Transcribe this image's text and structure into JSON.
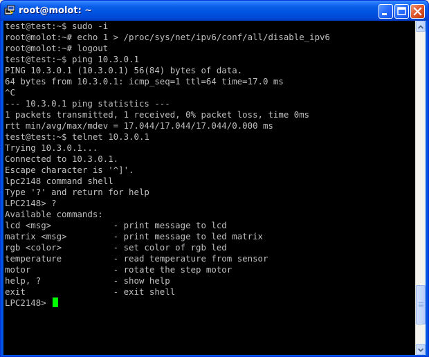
{
  "window": {
    "title": "root@molot: ~",
    "icons": {
      "app": "putty-icon",
      "minimize": "minimize-icon",
      "maximize": "maximize-icon",
      "close": "close-icon"
    },
    "colors": {
      "titlebar": "#0054e3",
      "close_button": "#e05a30"
    }
  },
  "terminal": {
    "colors": {
      "background": "#000000",
      "foreground": "#c0c0c0",
      "cursor": "#00ff00"
    },
    "lines": [
      "test@test:~$ sudo -i",
      "root@molot:~# echo 1 > /proc/sys/net/ipv6/conf/all/disable_ipv6",
      "root@molot:~# logout",
      "test@test:~$ ping 10.3.0.1",
      "PING 10.3.0.1 (10.3.0.1) 56(84) bytes of data.",
      "64 bytes from 10.3.0.1: icmp_seq=1 ttl=64 time=17.0 ms",
      "^C",
      "--- 10.3.0.1 ping statistics ---",
      "1 packets transmitted, 1 received, 0% packet loss, time 0ms",
      "rtt min/avg/max/mdev = 17.044/17.044/17.044/0.000 ms",
      "test@test:~$ telnet 10.3.0.1",
      "Trying 10.3.0.1...",
      "Connected to 10.3.0.1.",
      "Escape character is '^]'.",
      "lpc2148 command shell",
      "Type '?' and return for help",
      "LPC2148> ?",
      "Available commands:",
      "lcd <msg>            - print message to lcd",
      "matrix <msg>         - print message to led matrix",
      "rgb <color>          - set color of rgb led",
      "temperature          - read temperature from sensor",
      "motor                - rotate the step motor",
      "help, ?              - show help",
      "exit                 - exit shell"
    ],
    "prompt": "LPC2148> "
  },
  "scrollbar": {
    "position_fraction": 0.93
  }
}
